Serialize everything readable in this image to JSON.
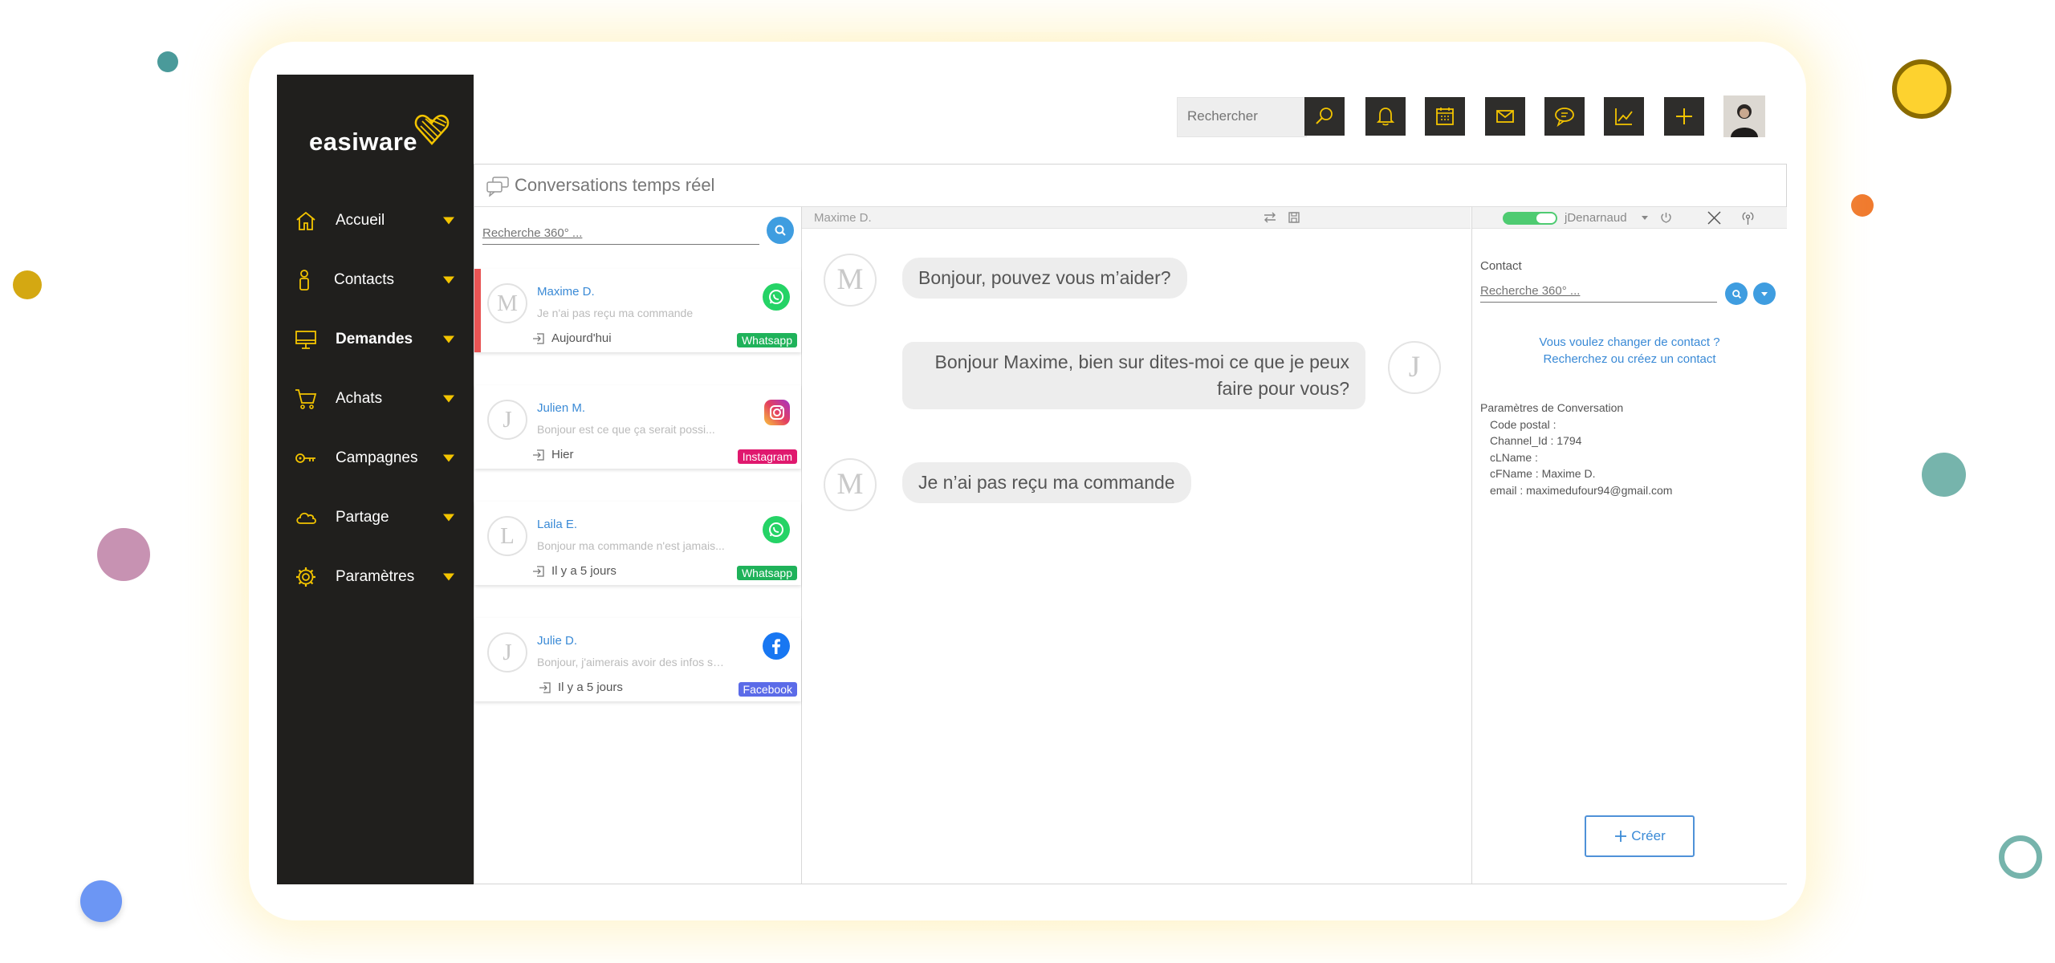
{
  "brand": {
    "logo_text": "easiware"
  },
  "sidebar": {
    "items": [
      {
        "label": "Accueil",
        "icon": "home-icon"
      },
      {
        "label": "Contacts",
        "icon": "person-icon"
      },
      {
        "label": "Demandes",
        "icon": "monitor-icon"
      },
      {
        "label": "Achats",
        "icon": "cart-icon"
      },
      {
        "label": "Campagnes",
        "icon": "key-icon"
      },
      {
        "label": "Partage",
        "icon": "cloud-icon"
      },
      {
        "label": "Paramètres",
        "icon": "gear-icon"
      }
    ]
  },
  "topbar": {
    "search_placeholder": "Rechercher",
    "buttons": [
      "search-icon",
      "bell-icon",
      "calendar-icon",
      "mail-icon",
      "chat-icon",
      "chart-icon",
      "plus-icon"
    ]
  },
  "page": {
    "title": "Conversations temps réel"
  },
  "conv_list": {
    "search_placeholder": "Recherche 360° ...",
    "items": [
      {
        "initial": "M",
        "name": "Maxime D.",
        "message": "Je n'ai pas reçu ma commande",
        "time": "Aujourd'hui",
        "channel": "Whatsapp",
        "channel_color": "#1fb25a"
      },
      {
        "initial": "J",
        "name": "Julien M.",
        "message": "Bonjour est ce que ça serait possi...",
        "time": "Hier",
        "channel": "Instagram",
        "channel_color": "#e0186e"
      },
      {
        "initial": "L",
        "name": "Laila E.",
        "message": "Bonjour ma commande n'est jamais...",
        "time": "Il y a 5 jours",
        "channel": "Whatsapp",
        "channel_color": "#1fb25a"
      },
      {
        "initial": "J",
        "name": "Julie D.",
        "message": "Bonjour, j'aimerais avoir des infos supp...",
        "time": "Il y a 5 jours",
        "channel": "Facebook",
        "channel_color": "#5b6be8"
      }
    ]
  },
  "chat": {
    "header_name": "Maxime D.",
    "messages": [
      {
        "initial": "M",
        "text": "Bonjour, pouvez vous m’aider?"
      },
      {
        "initial": "J",
        "text_line1": "Bonjour Maxime, bien sur dites-moi ce que je peux",
        "text_line2": "faire pour vous?"
      },
      {
        "initial": "M",
        "text": "Je n’ai pas reçu ma commande"
      }
    ]
  },
  "contact_panel": {
    "user": "jDenarnaud",
    "contact_label": "Contact",
    "search_placeholder": "Recherche 360° ...",
    "change_line1": "Vous voulez changer de contact ?",
    "change_line2": "Recherchez ou créez un contact",
    "params_title": "Paramètres de Conversation",
    "params": [
      "Code postal :",
      "Channel_Id : 1794",
      "cLName :",
      "cFName : Maxime D.",
      "email : maximedufour94@gmail.com"
    ],
    "create_label": "Créer"
  }
}
